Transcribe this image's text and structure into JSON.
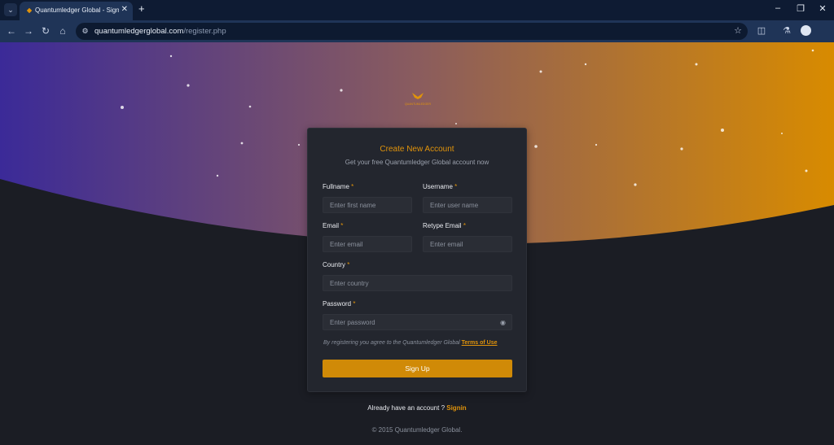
{
  "browser": {
    "tab_title": "Quantumledger Global - Sign U",
    "url_domain": "quantumledgerglobal.com",
    "url_path": "/register.php"
  },
  "logo_text": "QUANTUMLEDGER",
  "form": {
    "title": "Create New Account",
    "subtitle": "Get your free Quantumledger Global account now",
    "fullname": {
      "label": "Fullname",
      "placeholder": "Enter first name"
    },
    "username": {
      "label": "Username",
      "placeholder": "Enter user name"
    },
    "email": {
      "label": "Email",
      "placeholder": "Enter email"
    },
    "retype_email": {
      "label": "Retype Email",
      "placeholder": "Enter email"
    },
    "country": {
      "label": "Country",
      "placeholder": "Enter country"
    },
    "password": {
      "label": "Password",
      "placeholder": "Enter password"
    },
    "required_marker": "*",
    "terms_text": "By registering you agree to the Quantumledger Global ",
    "terms_link": "Terms of Use",
    "submit_label": "Sign Up"
  },
  "footer": {
    "already_text": "Already have an account ? ",
    "signin_link": "Signin",
    "copyright": "© 2015 Quantumledger Global."
  },
  "colors": {
    "gradient_left": "#3b2a98",
    "gradient_mid": "#8a5c5e",
    "gradient_right": "#d88b00",
    "accent": "#e0930b",
    "page_bg": "#1b1d24",
    "card_bg": "#23262e"
  }
}
